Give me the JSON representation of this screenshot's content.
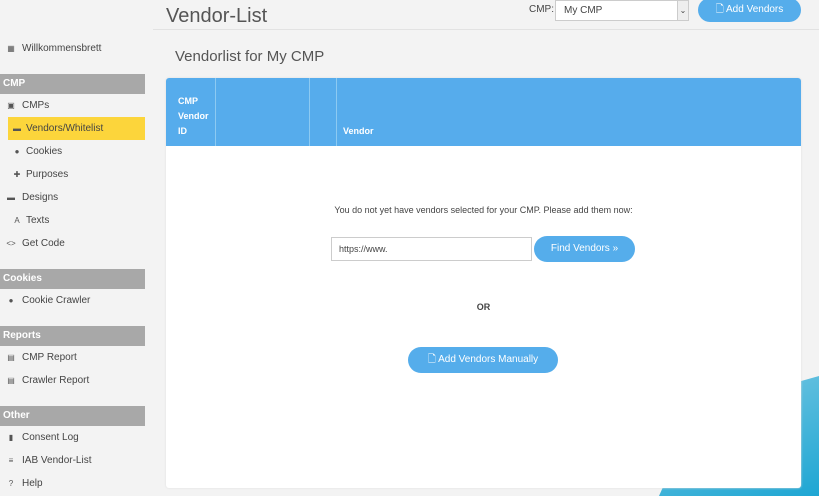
{
  "sidebar": {
    "dashboard": "Willkommensbrett",
    "sections": [
      {
        "title": "CMP"
      },
      {
        "title": "Cookies"
      },
      {
        "title": "Reports"
      },
      {
        "title": "Other"
      }
    ],
    "items": {
      "cmps": "CMPs",
      "vendors": "Vendors/Whitelist",
      "cookies": "Cookies",
      "purposes": "Purposes",
      "designs": "Designs",
      "texts": "Texts",
      "getcode": "Get Code",
      "crawler": "Cookie Crawler",
      "cmpreport": "CMP Report",
      "crawlerreport": "Crawler Report",
      "consentlog": "Consent Log",
      "iab": "IAB Vendor-List",
      "help": "Help"
    },
    "active_color": "#fcd53b"
  },
  "header": {
    "title": "Vendor-List",
    "cmp_label": "CMP:",
    "cmp_selected": "My CMP",
    "add_vendors": "Add Vendors"
  },
  "main": {
    "subtitle": "Vendorlist for My CMP",
    "columns": [
      "CMP Vendor ID",
      "",
      "",
      "Vendor"
    ],
    "empty_message": "You do not yet have vendors selected for your CMP. Please add them now:",
    "url_value": "https://www.",
    "find_button": "Find Vendors »",
    "or_label": "OR",
    "add_manually": "Add Vendors Manually"
  },
  "colors": {
    "accent": "#56acec"
  }
}
